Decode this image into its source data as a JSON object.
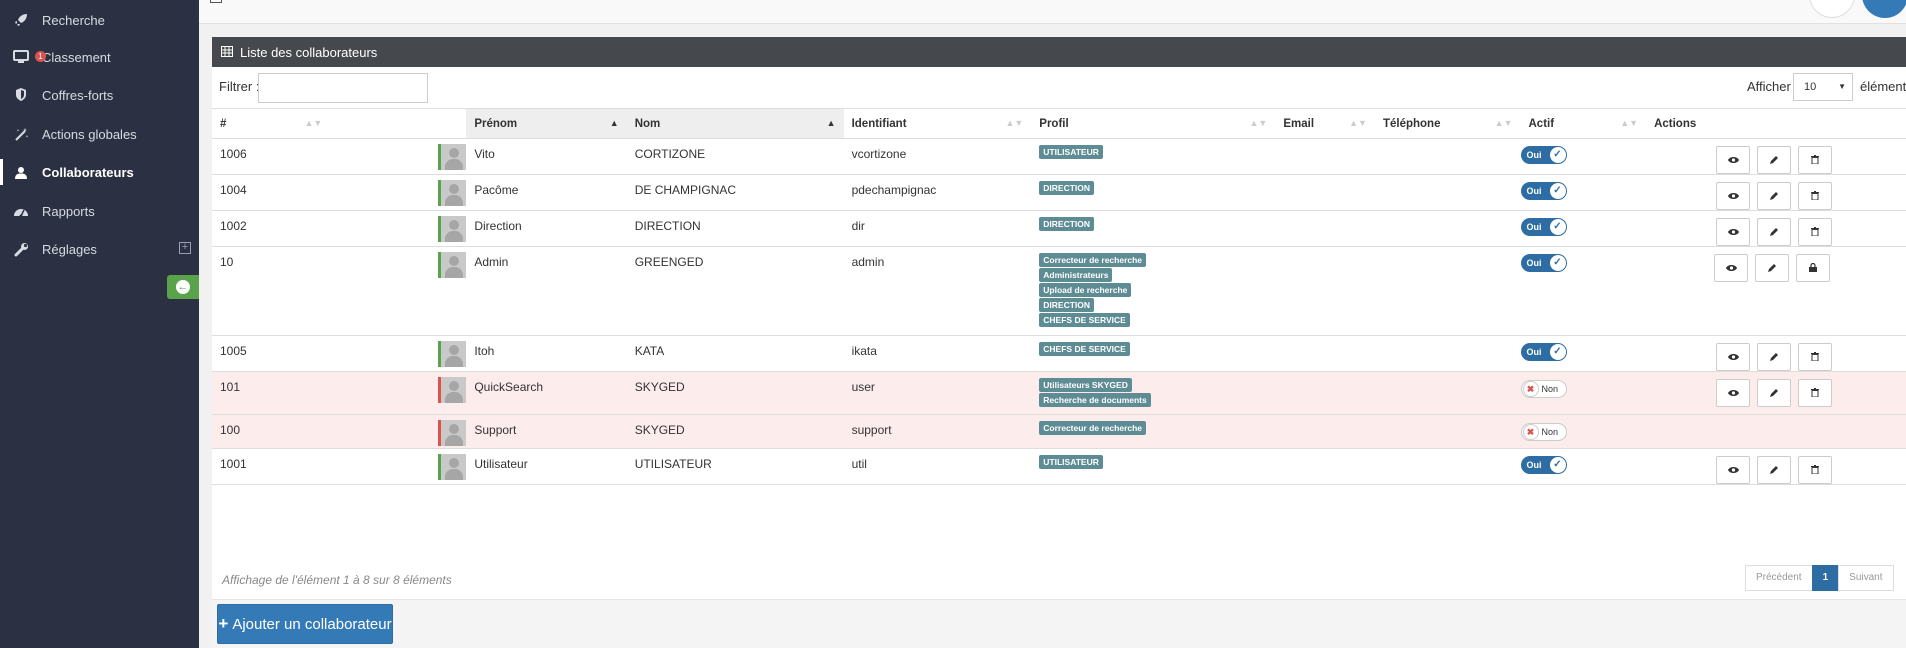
{
  "sidebar": {
    "items": [
      {
        "label": "Recherche",
        "icon": "rocket-icon"
      },
      {
        "label": "Classement",
        "icon": "monitor-icon",
        "badge": "1"
      },
      {
        "label": "Coffres-forts",
        "icon": "shield-icon"
      },
      {
        "label": "Actions globales",
        "icon": "magic-wand-icon"
      },
      {
        "label": "Collaborateurs",
        "icon": "user-icon",
        "active": true
      },
      {
        "label": "Rapports",
        "icon": "dashboard-icon"
      },
      {
        "label": "Réglages",
        "icon": "wrench-icon",
        "expandable": true
      }
    ]
  },
  "panel": {
    "title": "Liste des collaborateurs",
    "filter_label": "Filtrer :",
    "filter_value": "",
    "show_label": "Afficher",
    "show_value": "10",
    "show_after": "éléments"
  },
  "table": {
    "headers": [
      "#",
      "",
      "Prénom",
      "Nom",
      "Identifiant",
      "Profil",
      "Email",
      "Téléphone",
      "Actif",
      "Actions"
    ],
    "rows": [
      {
        "id": "1006",
        "prenom": "Vito",
        "nom": "CORTIZONE",
        "identifiant": "vcortizone",
        "profils": [
          "UTILISATEUR"
        ],
        "actif": "Oui",
        "active": true
      },
      {
        "id": "1004",
        "prenom": "Pacôme",
        "nom": "DE CHAMPIGNAC",
        "identifiant": "pdechampignac",
        "profils": [
          "DIRECTION"
        ],
        "actif": "Oui",
        "active": true
      },
      {
        "id": "1002",
        "prenom": "Direction",
        "nom": "DIRECTION",
        "identifiant": "dir",
        "profils": [
          "DIRECTION"
        ],
        "actif": "Oui",
        "active": true
      },
      {
        "id": "10",
        "prenom": "Admin",
        "nom": "GREENGED",
        "identifiant": "admin",
        "profils": [
          "Correcteur de recherche",
          "Administrateurs",
          "Upload de recherche",
          "DIRECTION",
          "CHEFS DE SERVICE"
        ],
        "actif": "Oui",
        "active": true,
        "locked": true
      },
      {
        "id": "1005",
        "prenom": "Itoh",
        "nom": "KATA",
        "identifiant": "ikata",
        "profils": [
          "CHEFS DE SERVICE"
        ],
        "actif": "Oui",
        "active": true
      },
      {
        "id": "101",
        "prenom": "QuickSearch",
        "nom": "SKYGED",
        "identifiant": "user",
        "profils": [
          "Utilisateurs SKYGED",
          "Recherche de documents"
        ],
        "actif": "Non",
        "active": false
      },
      {
        "id": "100",
        "prenom": "Support",
        "nom": "SKYGED",
        "identifiant": "support",
        "profils": [
          "Correcteur de recherche"
        ],
        "actif": "Non",
        "active": false,
        "no_actions": true
      },
      {
        "id": "1001",
        "prenom": "Utilisateur",
        "nom": "UTILISATEUR",
        "identifiant": "util",
        "profils": [
          "UTILISATEUR"
        ],
        "actif": "Oui",
        "active": true
      }
    ]
  },
  "footer": {
    "info": "Affichage de l'élément 1 à 8 sur 8 éléments",
    "prev": "Précédent",
    "page": "1",
    "next": "Suivant",
    "add_button": "Ajouter un collaborateur"
  },
  "colors": {
    "sidebar_bg": "#2b3142",
    "panel_head": "#45484d",
    "primary": "#337ab7",
    "profile_label": "#5e8c94",
    "inactive_row": "#fdecec"
  }
}
